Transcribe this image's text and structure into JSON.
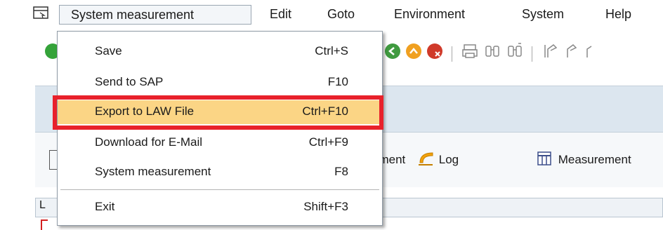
{
  "menubar": {
    "items": [
      {
        "label": "System measurement"
      },
      {
        "label": "Edit"
      },
      {
        "label": "Goto"
      },
      {
        "label": "Environment"
      },
      {
        "label": "System"
      },
      {
        "label": "Help"
      }
    ]
  },
  "dropdown": {
    "items": [
      {
        "label": "Save",
        "shortcut": "Ctrl+S"
      },
      {
        "label": "Send to SAP",
        "shortcut": "F10"
      },
      {
        "label": "Export to LAW File",
        "shortcut": "Ctrl+F10",
        "highlighted": true
      },
      {
        "label": "Download for E-Mail",
        "shortcut": "Ctrl+F9"
      },
      {
        "label": "System measurement",
        "shortcut": "F8"
      },
      {
        "label": "Exit",
        "shortcut": "Shift+F3"
      }
    ]
  },
  "appbar": {
    "measure_fragment": "ement",
    "log_label": "Log",
    "measurement_label": "Measurement"
  },
  "grid": {
    "header_fragment": "L"
  },
  "colors": {
    "highlight_fill": "#fbd585",
    "highlight_frame": "#e8212b",
    "titlebar": "#dce6ef"
  }
}
